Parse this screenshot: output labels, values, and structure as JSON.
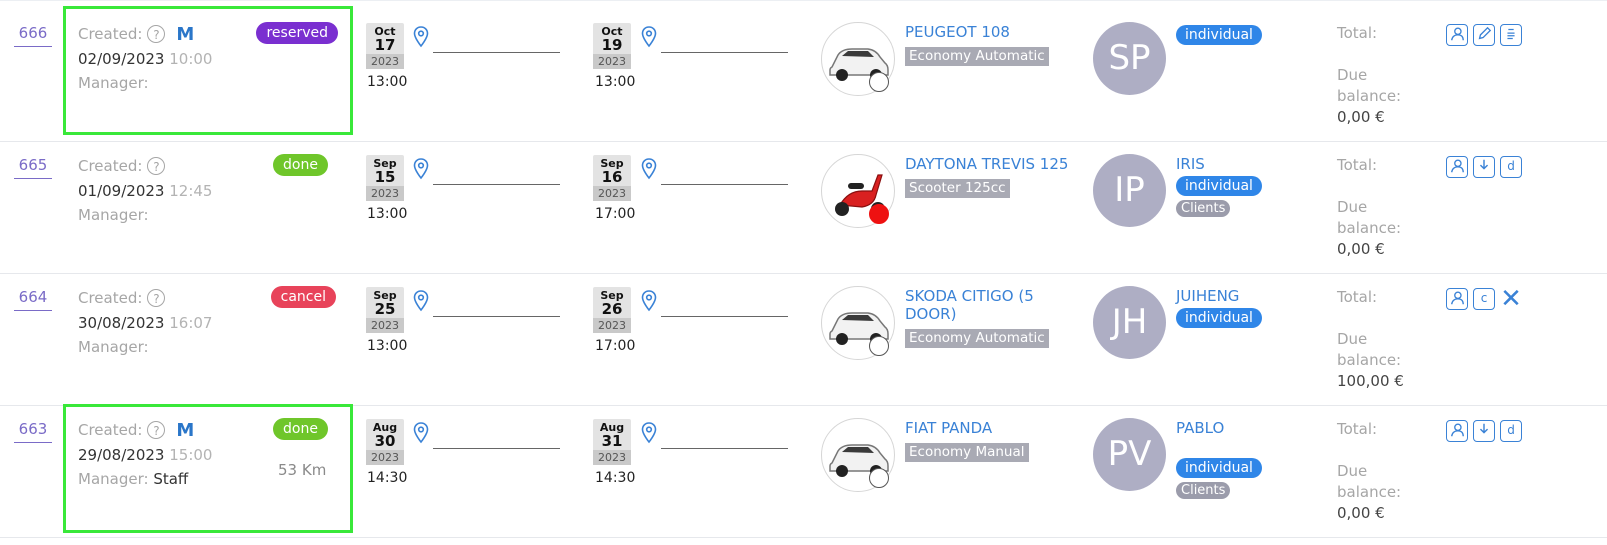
{
  "rows": [
    {
      "id": "666",
      "created_label": "Created:",
      "help_icon": "?",
      "logo": "M",
      "date": "02/09/2023",
      "time": "10:00",
      "manager_label": "Manager:",
      "manager_name": "",
      "status": "reserved",
      "status_color": "#7a2fd0",
      "km": "",
      "pickup": {
        "mon": "Oct",
        "day": "17",
        "yr": "2023",
        "time": "13:00"
      },
      "dropoff": {
        "mon": "Oct",
        "day": "19",
        "yr": "2023",
        "time": "13:00"
      },
      "vehicle": "PEUGEOT 108",
      "category": "Economy Automatic",
      "car_dot": "empty",
      "initials": "SP",
      "client_name": "",
      "client_type": "individual",
      "client_group": "",
      "total_label": "Total:",
      "due_label_1": "Due",
      "due_label_2": "balance:",
      "due_amount": "0,00 €",
      "actions": [
        "user-icon",
        "edit-icon",
        "clipboard-icon"
      ]
    },
    {
      "id": "665",
      "created_label": "Created:",
      "help_icon": "?",
      "logo": "",
      "date": "01/09/2023",
      "time": "12:45",
      "manager_label": "Manager:",
      "manager_name": "",
      "status": "done",
      "status_color": "#6fc62a",
      "km": "",
      "pickup": {
        "mon": "Sep",
        "day": "15",
        "yr": "2023",
        "time": "13:00"
      },
      "dropoff": {
        "mon": "Sep",
        "day": "16",
        "yr": "2023",
        "time": "17:00"
      },
      "vehicle": "DAYTONA TREVIS 125",
      "category": "Scooter 125cc",
      "car_dot": "red",
      "initials": "IP",
      "client_name": "IRIS",
      "client_type": "individual",
      "client_group": "Clients",
      "total_label": "Total:",
      "due_label_1": "Due",
      "due_label_2": "balance:",
      "due_amount": "0,00 €",
      "actions": [
        "user-icon",
        "download-icon",
        "d-icon"
      ]
    },
    {
      "id": "664",
      "created_label": "Created:",
      "help_icon": "?",
      "logo": "",
      "date": "30/08/2023",
      "time": "16:07",
      "manager_label": "Manager:",
      "manager_name": "",
      "status": "cancel",
      "status_color": "#e8435a",
      "km": "",
      "pickup": {
        "mon": "Sep",
        "day": "25",
        "yr": "2023",
        "time": "13:00"
      },
      "dropoff": {
        "mon": "Sep",
        "day": "26",
        "yr": "2023",
        "time": "17:00"
      },
      "vehicle": "SKODA CITIGO (5 DOOR)",
      "category": "Economy Automatic",
      "car_dot": "empty",
      "initials": "JH",
      "client_name": "JUIHENG",
      "client_type": "individual",
      "client_group": "",
      "total_label": "Total:",
      "due_label_1": "Due",
      "due_label_2": "balance:",
      "due_amount": "100,00 €",
      "actions": [
        "user-icon",
        "c-icon",
        "close-icon"
      ]
    },
    {
      "id": "663",
      "created_label": "Created:",
      "help_icon": "?",
      "logo": "M",
      "date": "29/08/2023",
      "time": "15:00",
      "manager_label": "Manager:",
      "manager_name": "Staff",
      "status": "done",
      "status_color": "#6fc62a",
      "km": "53 Km",
      "pickup": {
        "mon": "Aug",
        "day": "30",
        "yr": "2023",
        "time": "14:30"
      },
      "dropoff": {
        "mon": "Aug",
        "day": "31",
        "yr": "2023",
        "time": "14:30"
      },
      "vehicle": "FIAT PANDA",
      "category": "Economy Manual",
      "car_dot": "empty",
      "initials": "PV",
      "client_name": "PABLO",
      "client_type": "individual",
      "client_group": "Clients",
      "total_label": "Total:",
      "due_label_1": "Due",
      "due_label_2": "balance:",
      "due_amount": "0,00 €",
      "actions": [
        "user-icon",
        "download-icon",
        "d-icon"
      ]
    }
  ],
  "highlight_color": "#39e839"
}
